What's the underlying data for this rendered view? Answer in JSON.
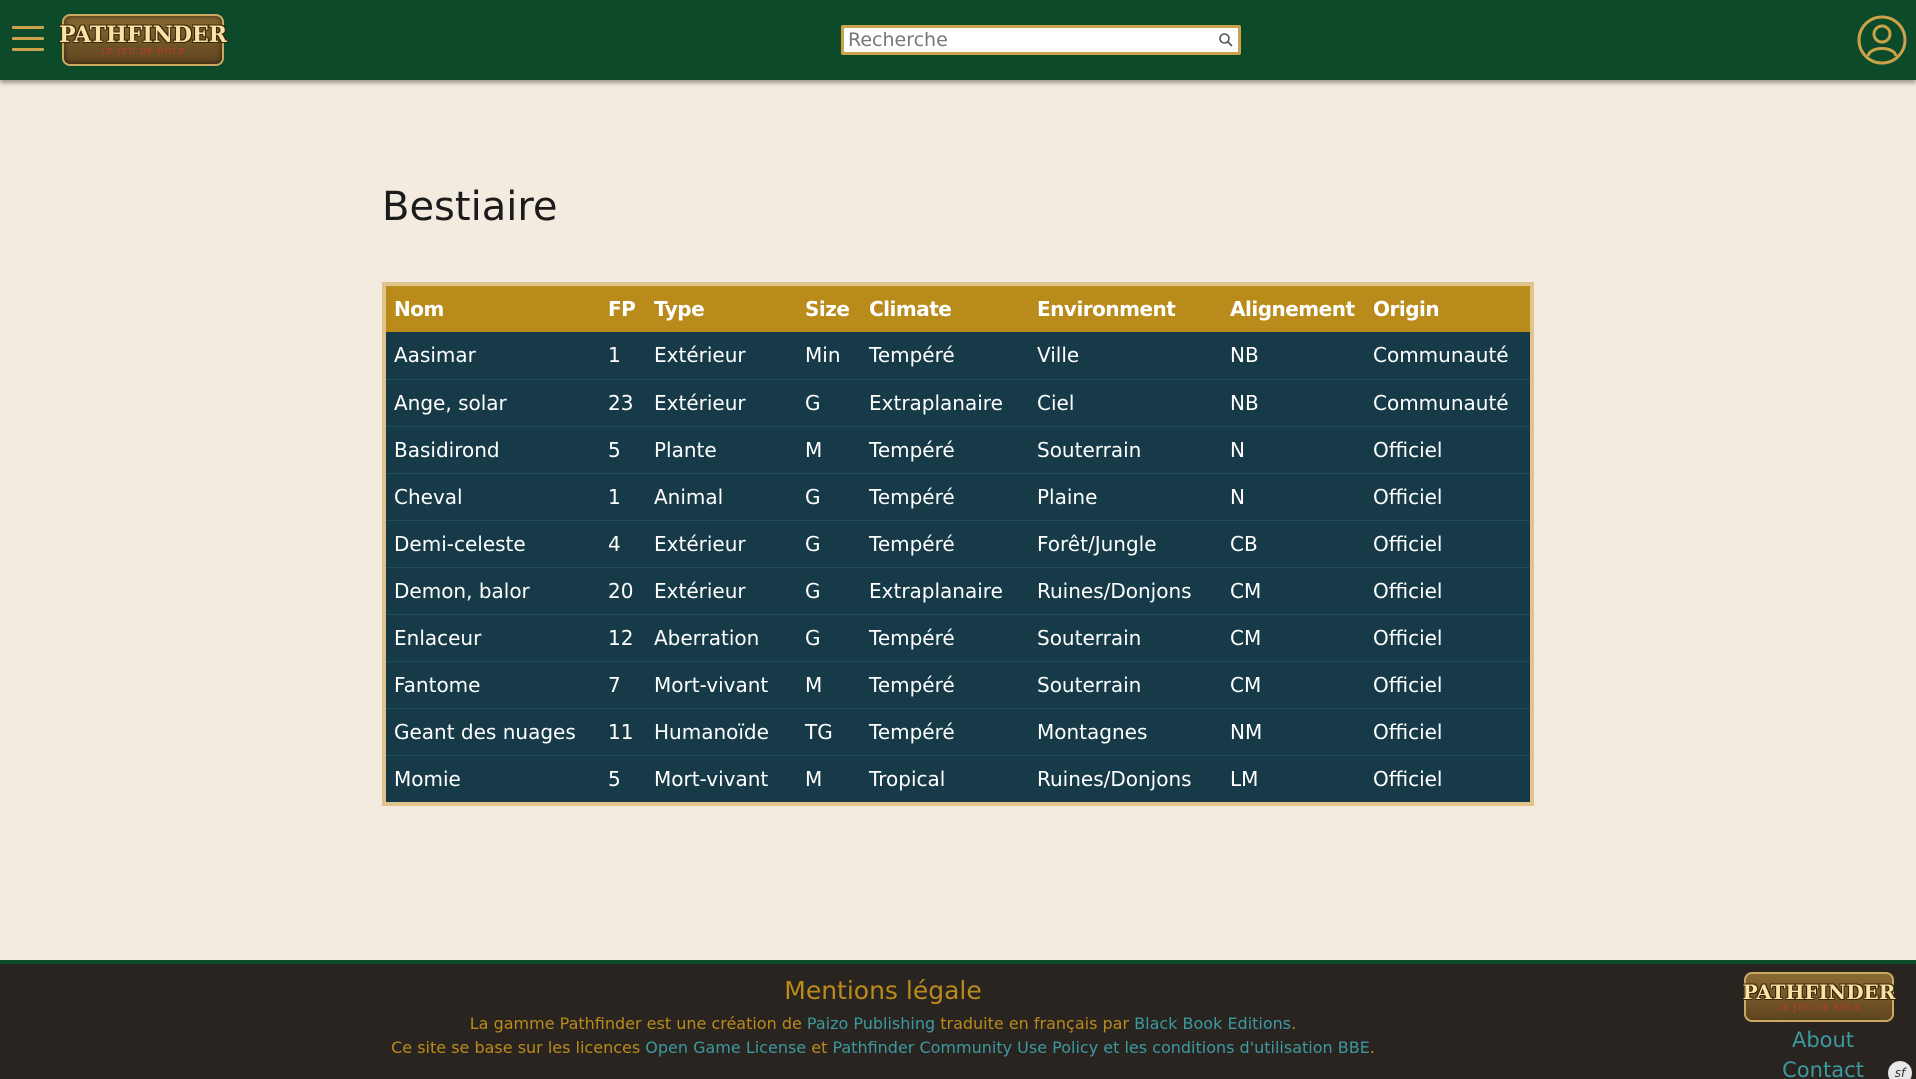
{
  "header": {
    "logo_text": "PATHFINDER",
    "logo_subtitle": "LE JEU DE RÔLE",
    "search_placeholder": "Recherche"
  },
  "page": {
    "title": "Bestiaire"
  },
  "table": {
    "columns": [
      "Nom",
      "FP",
      "Type",
      "Size",
      "Climate",
      "Environment",
      "Alignement",
      "Origin"
    ],
    "rows": [
      [
        "Aasimar",
        "1",
        "Extérieur",
        "Min",
        "Tempéré",
        "Ville",
        "NB",
        "Communauté"
      ],
      [
        "Ange, solar",
        "23",
        "Extérieur",
        "G",
        "Extraplanaire",
        "Ciel",
        "NB",
        "Communauté"
      ],
      [
        "Basidirond",
        "5",
        "Plante",
        "M",
        "Tempéré",
        "Souterrain",
        "N",
        "Officiel"
      ],
      [
        "Cheval",
        "1",
        "Animal",
        "G",
        "Tempéré",
        "Plaine",
        "N",
        "Officiel"
      ],
      [
        "Demi-celeste",
        "4",
        "Extérieur",
        "G",
        "Tempéré",
        "Forêt/Jungle",
        "CB",
        "Officiel"
      ],
      [
        "Demon, balor",
        "20",
        "Extérieur",
        "G",
        "Extraplanaire",
        "Ruines/Donjons",
        "CM",
        "Officiel"
      ],
      [
        "Enlaceur",
        "12",
        "Aberration",
        "G",
        "Tempéré",
        "Souterrain",
        "CM",
        "Officiel"
      ],
      [
        "Fantome",
        "7",
        "Mort-vivant",
        "M",
        "Tempéré",
        "Souterrain",
        "CM",
        "Officiel"
      ],
      [
        "Geant des nuages",
        "11",
        "Humanoïde",
        "TG",
        "Tempéré",
        "Montagnes",
        "NM",
        "Officiel"
      ],
      [
        "Momie",
        "5",
        "Mort-vivant",
        "M",
        "Tropical",
        "Ruines/Donjons",
        "LM",
        "Officiel"
      ]
    ]
  },
  "footer": {
    "title": "Mentions légale",
    "line1_prefix": "La gamme Pathfinder est une création de ",
    "line1_link1": "Paizo Publishing",
    "line1_middle": " traduite en français par ",
    "line1_link2": "Black Book Editions",
    "line1_suffix": ".",
    "line2_prefix": "Ce site se base sur les licences ",
    "line2_link1": "Open Game License",
    "line2_middle": " et ",
    "line2_link2": "Pathfinder Community Use Policy et les conditions d'utilisation BBE",
    "line2_suffix": ".",
    "about_label": "About",
    "contact_label": "Contact",
    "badge_text": "sf"
  },
  "colors": {
    "header_bg": "#0c4a2a",
    "page_bg": "#f3ebdf",
    "table_header_bg": "#b98b1b",
    "table_body_bg": "#163a48",
    "footer_bg": "#2a2420",
    "accent_gold": "#b98b1b",
    "link_teal": "#3a9aa0"
  },
  "icons": {
    "menu": "hamburger-menu-icon",
    "search": "search-icon",
    "user": "user-account-icon"
  }
}
